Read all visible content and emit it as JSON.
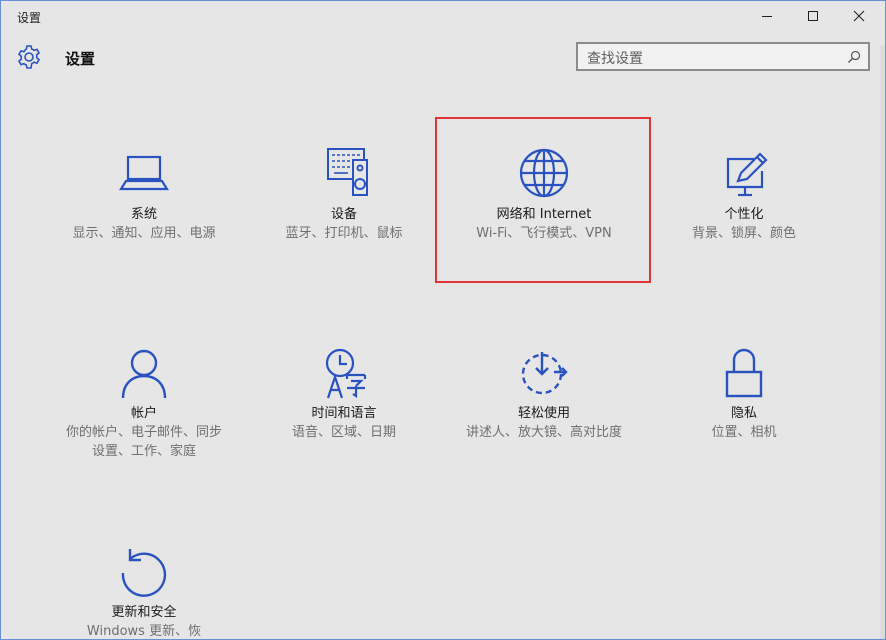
{
  "window": {
    "title": "设置"
  },
  "header": {
    "title": "设置",
    "search_placeholder": "查找设置"
  },
  "tiles": [
    {
      "name": "系统",
      "desc": "显示、通知、应用、电源",
      "icon": "laptop-icon"
    },
    {
      "name": "设备",
      "desc": "蓝牙、打印机、鼠标",
      "icon": "devices-icon"
    },
    {
      "name": "网络和 Internet",
      "desc": "Wi-Fi、飞行模式、VPN",
      "icon": "globe-icon"
    },
    {
      "name": "个性化",
      "desc": "背景、锁屏、颜色",
      "icon": "personalization-icon"
    },
    {
      "name": "帐户",
      "desc": "你的帐户、电子邮件、同步设置、工作、家庭",
      "icon": "person-icon"
    },
    {
      "name": "时间和语言",
      "desc": "语音、区域、日期",
      "icon": "time-language-icon"
    },
    {
      "name": "轻松使用",
      "desc": "讲述人、放大镜、高对比度",
      "icon": "ease-of-access-icon"
    },
    {
      "name": "隐私",
      "desc": "位置、相机",
      "icon": "lock-icon"
    },
    {
      "name": "更新和安全",
      "desc": "Windows 更新、恢",
      "icon": "update-icon"
    }
  ],
  "colors": {
    "accent": "#2a53c1",
    "highlight": "#e0363a",
    "background": "#e6e6e6"
  }
}
